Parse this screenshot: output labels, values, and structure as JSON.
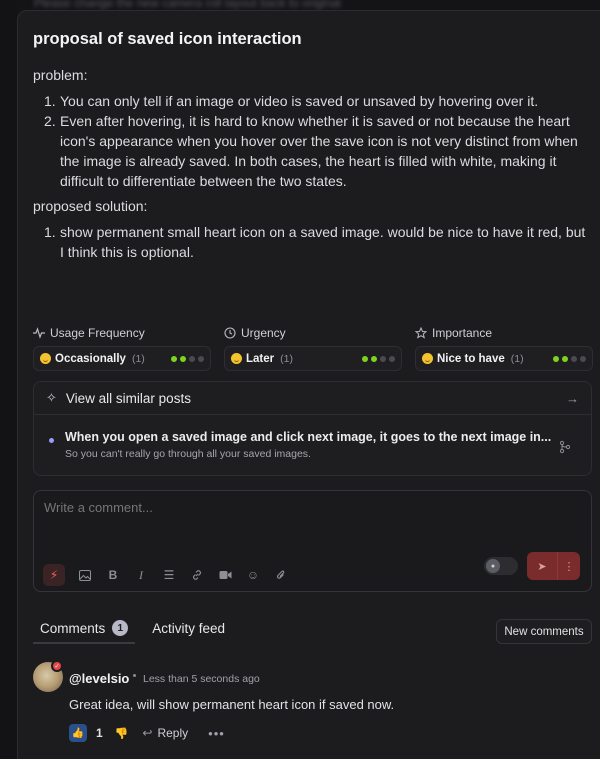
{
  "bg_text": "Please change the new camera roll layout back to original",
  "post": {
    "title": "proposal of saved icon interaction",
    "problem_label": "problem:",
    "problem_items": [
      "You can only tell if an image or video is saved or unsaved by hovering over it.",
      "Even after hovering, it is hard to know whether it is saved or not because the heart icon's appearance when you hover over the save icon is not very distinct from when the image is already saved. In both cases, the heart is filled with white, making it difficult to differentiate between the two states."
    ],
    "solution_label": "proposed solution:",
    "solution_items": [
      "show permanent small heart icon on a saved image. would be nice to have it red, but I think this is optional."
    ]
  },
  "meta": [
    {
      "label": "Usage Frequency",
      "icon": "pulse-icon",
      "value": "Occasionally",
      "count": "(1)",
      "level": 2
    },
    {
      "label": "Urgency",
      "icon": "clock-icon",
      "value": "Later",
      "count": "(1)",
      "level": 2
    },
    {
      "label": "Importance",
      "icon": "star-icon",
      "value": "Nice to have",
      "count": "(1)",
      "level": 2
    }
  ],
  "similar": {
    "header": "View all similar posts",
    "items": [
      {
        "title": "When you open a saved image and click next image, it goes to the next image in...",
        "subtitle": "So you can't really go through all your saved images."
      }
    ]
  },
  "composer": {
    "placeholder": "Write a comment..."
  },
  "tabs": {
    "comments": "Comments",
    "comments_count": "1",
    "activity": "Activity feed",
    "new_comments": "New comments"
  },
  "comment": {
    "user": "@levelsio",
    "time": "Less than 5 seconds ago",
    "text": "Great idea, will show permanent heart icon if saved now.",
    "likes": "1",
    "reply_label": "Reply"
  },
  "colors": {
    "accent_red": "#7a2b2b",
    "level_green": "#7ed321",
    "like_blue": "#2a4f8a"
  }
}
